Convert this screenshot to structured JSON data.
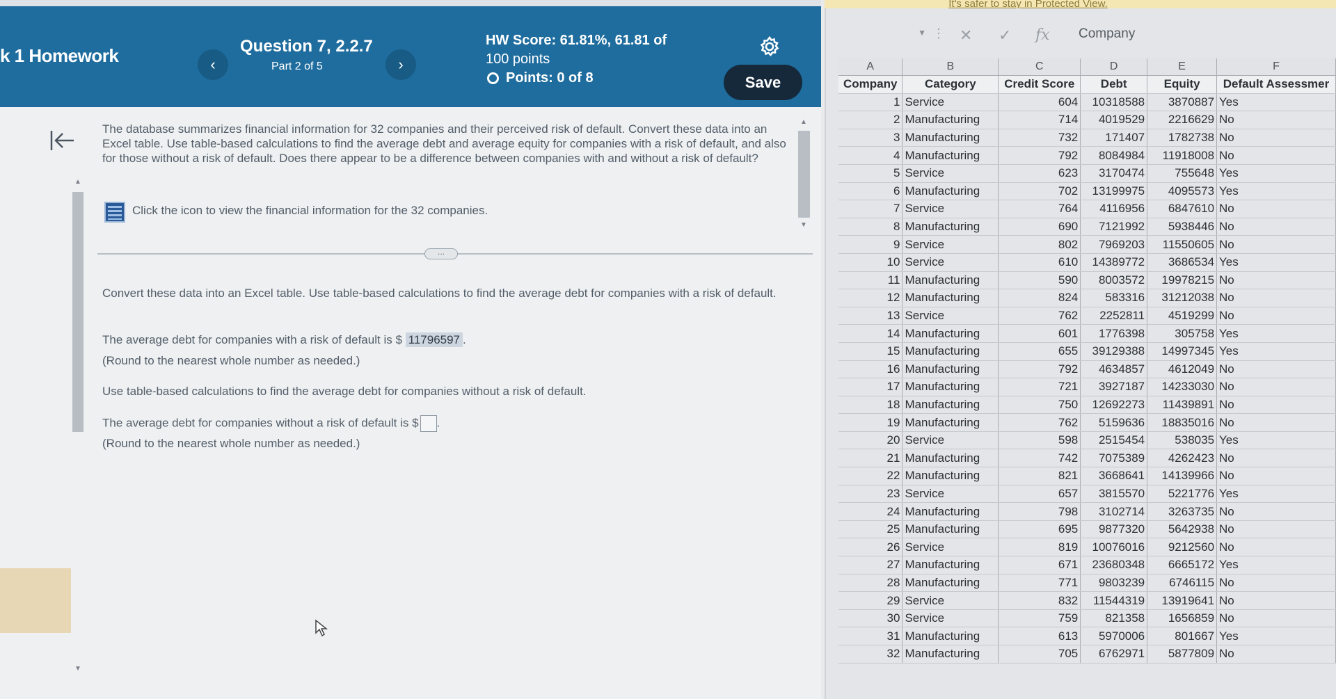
{
  "header": {
    "course_title": "k 1 Homework",
    "prev_icon": "chevron-left-icon",
    "next_icon": "chevron-right-icon",
    "question_title": "Question 7, 2.2.7",
    "question_part": "Part 2 of 5",
    "hw_score_label": "HW Score: 61.81%, 61.81 of",
    "hw_score_points": "100 points",
    "points_text": "Points: 0 of 8",
    "settings_icon": "gear-icon",
    "save_label": "Save"
  },
  "question": {
    "intro": "The database summarizes financial information for 32 companies and their perceived risk of default. Convert these data into an Excel table. Use table-based calculations to find the average debt and average equity for companies with a risk of default, and also for those without a risk of default. Does there appear to be a difference between companies with and without a risk of default?",
    "icon_prompt": "Click the icon to view the financial information for the 32 companies.",
    "divider_handle": "...",
    "part2_instruction": "Convert these data into an Excel table. Use table-based calculations to find the average debt for companies with a risk of default.",
    "answer1_prefix": "The average debt for companies with a risk of default is $",
    "answer1_value": "11796597",
    "answer1_suffix": ".",
    "round_note_1": "(Round to the nearest whole number as needed.)",
    "part3_instruction": "Use table-based calculations to find the average debt for companies without a risk of default.",
    "answer2_prefix": "The average debt for companies without a risk of default is $",
    "answer2_suffix": ".",
    "round_note_2": "(Round to the nearest whole number as needed.)"
  },
  "excel": {
    "protected_banner": "It's safer to stay in Protected View.",
    "formula_value": "Company",
    "fx_label": "fx",
    "column_letters": [
      "A",
      "B",
      "C",
      "D",
      "E",
      "F"
    ],
    "headers": [
      "Company",
      "Category",
      "Credit Score",
      "Debt",
      "Equity",
      "Default Assessmer"
    ],
    "rows": [
      [
        "1",
        "Service",
        "604",
        "10318588",
        "3870887",
        "Yes"
      ],
      [
        "2",
        "Manufacturing",
        "714",
        "4019529",
        "2216629",
        "No"
      ],
      [
        "3",
        "Manufacturing",
        "732",
        "171407",
        "1782738",
        "No"
      ],
      [
        "4",
        "Manufacturing",
        "792",
        "8084984",
        "11918008",
        "No"
      ],
      [
        "5",
        "Service",
        "623",
        "3170474",
        "755648",
        "Yes"
      ],
      [
        "6",
        "Manufacturing",
        "702",
        "13199975",
        "4095573",
        "Yes"
      ],
      [
        "7",
        "Service",
        "764",
        "4116956",
        "6847610",
        "No"
      ],
      [
        "8",
        "Manufacturing",
        "690",
        "7121992",
        "5938446",
        "No"
      ],
      [
        "9",
        "Service",
        "802",
        "7969203",
        "11550605",
        "No"
      ],
      [
        "10",
        "Service",
        "610",
        "14389772",
        "3686534",
        "Yes"
      ],
      [
        "11",
        "Manufacturing",
        "590",
        "8003572",
        "19978215",
        "No"
      ],
      [
        "12",
        "Manufacturing",
        "824",
        "583316",
        "31212038",
        "No"
      ],
      [
        "13",
        "Service",
        "762",
        "2252811",
        "4519299",
        "No"
      ],
      [
        "14",
        "Manufacturing",
        "601",
        "1776398",
        "305758",
        "Yes"
      ],
      [
        "15",
        "Manufacturing",
        "655",
        "39129388",
        "14997345",
        "Yes"
      ],
      [
        "16",
        "Manufacturing",
        "792",
        "4634857",
        "4612049",
        "No"
      ],
      [
        "17",
        "Manufacturing",
        "721",
        "3927187",
        "14233030",
        "No"
      ],
      [
        "18",
        "Manufacturing",
        "750",
        "12692273",
        "11439891",
        "No"
      ],
      [
        "19",
        "Manufacturing",
        "762",
        "5159636",
        "18835016",
        "No"
      ],
      [
        "20",
        "Service",
        "598",
        "2515454",
        "538035",
        "Yes"
      ],
      [
        "21",
        "Manufacturing",
        "742",
        "7075389",
        "4262423",
        "No"
      ],
      [
        "22",
        "Manufacturing",
        "821",
        "3668641",
        "14139966",
        "No"
      ],
      [
        "23",
        "Service",
        "657",
        "3815570",
        "5221776",
        "Yes"
      ],
      [
        "24",
        "Manufacturing",
        "798",
        "3102714",
        "3263735",
        "No"
      ],
      [
        "25",
        "Manufacturing",
        "695",
        "9877320",
        "5642938",
        "No"
      ],
      [
        "26",
        "Service",
        "819",
        "10076016",
        "9212560",
        "No"
      ],
      [
        "27",
        "Manufacturing",
        "671",
        "23680348",
        "6665172",
        "Yes"
      ],
      [
        "28",
        "Manufacturing",
        "771",
        "9803239",
        "6746115",
        "No"
      ],
      [
        "29",
        "Service",
        "832",
        "11544319",
        "13919641",
        "No"
      ],
      [
        "30",
        "Service",
        "759",
        "821358",
        "1656859",
        "No"
      ],
      [
        "31",
        "Manufacturing",
        "613",
        "5970006",
        "801667",
        "Yes"
      ],
      [
        "32",
        "Manufacturing",
        "705",
        "6762971",
        "5877809",
        "No"
      ]
    ]
  }
}
